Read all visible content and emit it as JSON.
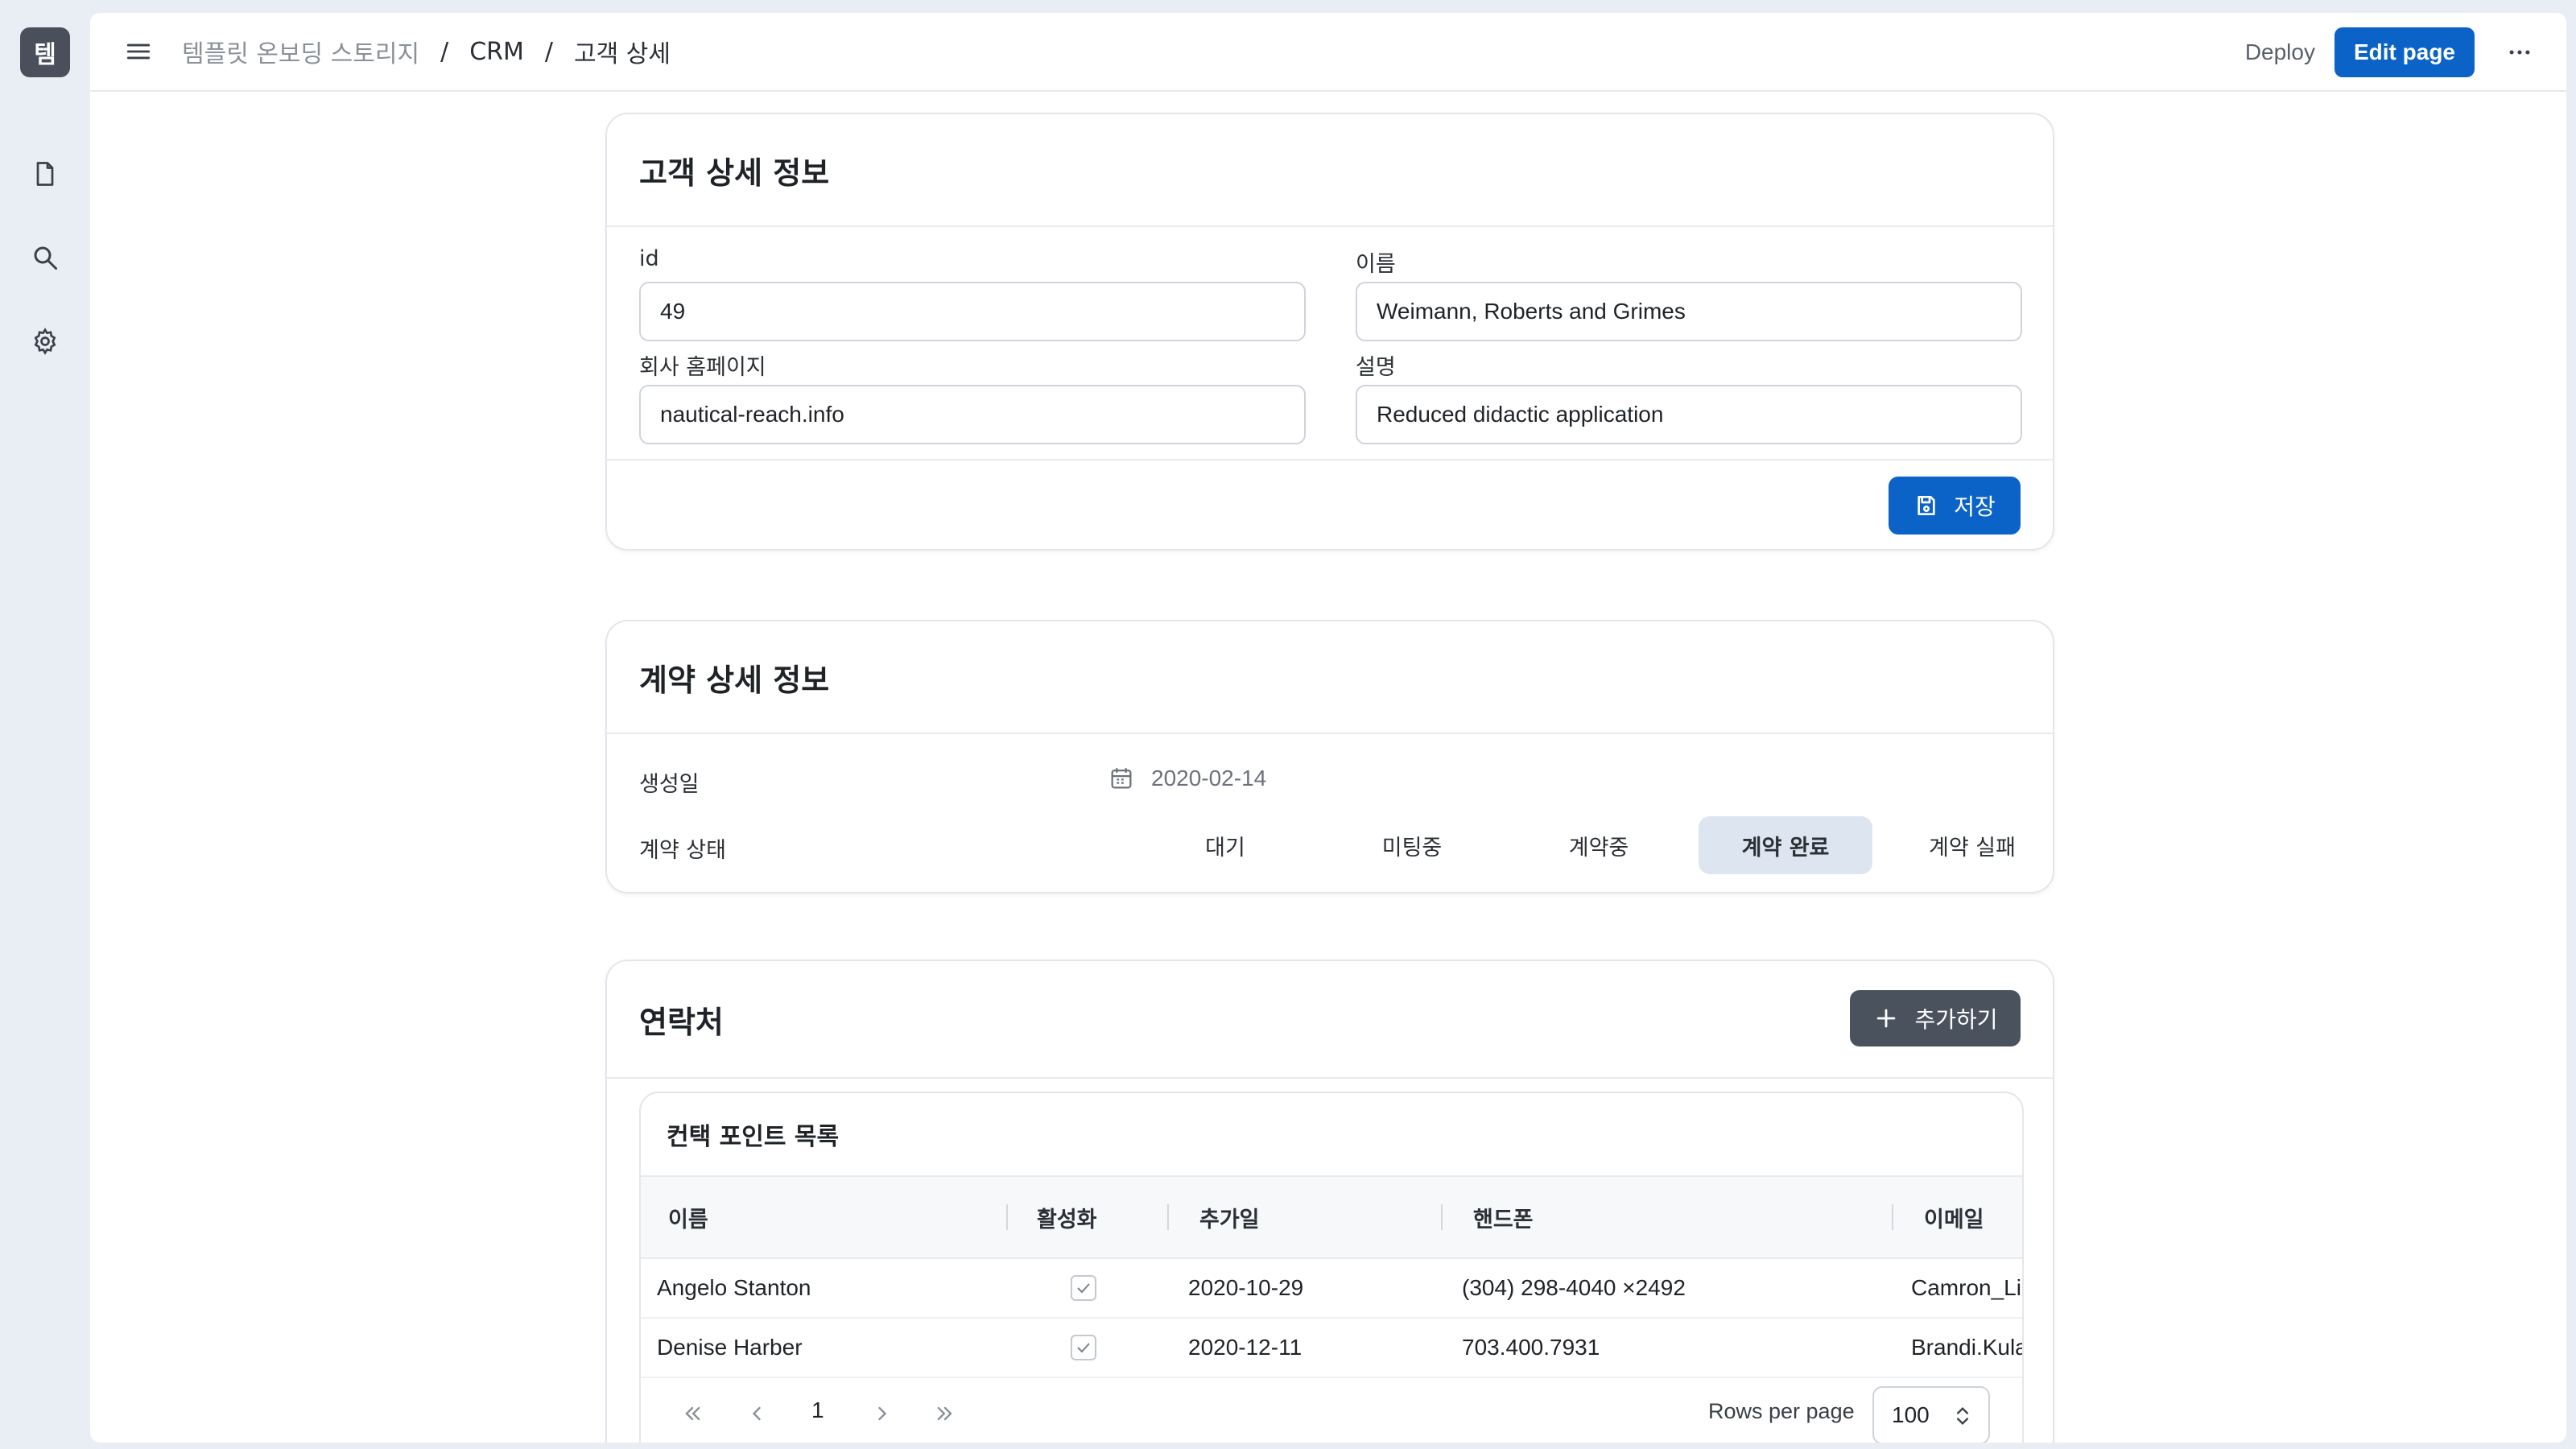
{
  "rail": {
    "app_badge": "템",
    "icons": [
      "document-icon",
      "search-icon",
      "gear-icon"
    ]
  },
  "topbar": {
    "breadcrumb": [
      "템플릿 온보딩 스토리지",
      "CRM",
      "고객 상세"
    ],
    "separator": "/",
    "deploy_label": "Deploy",
    "edit_label": "Edit page"
  },
  "customer_card": {
    "title": "고객 상세 정보",
    "fields": {
      "id_label": "id",
      "id_value": "49",
      "name_label": "이름",
      "name_value": "Weimann, Roberts and Grimes",
      "homepage_label": "회사 홈페이지",
      "homepage_value": "nautical-reach.info",
      "description_label": "설명",
      "description_value": "Reduced didactic application"
    },
    "save_label": "저장"
  },
  "contract_card": {
    "title": "계약 상세 정보",
    "created_label": "생성일",
    "created_value": "2020-02-14",
    "status_label": "계약 상태",
    "status_options": [
      "대기",
      "미팅중",
      "계약중",
      "계약 완료",
      "계약 실패"
    ],
    "status_selected": "계약 완료"
  },
  "contacts_card": {
    "title": "연락처",
    "add_label": "추가하기",
    "table": {
      "title": "컨택 포인트 목록",
      "columns": [
        "이름",
        "활성화",
        "추가일",
        "핸드폰",
        "이메일"
      ],
      "rows": [
        {
          "name": "Angelo Stanton",
          "active": true,
          "added": "2020-10-29",
          "phone": "(304) 298-4040 ×2492",
          "email": "Camron_Li"
        },
        {
          "name": "Denise Harber",
          "active": true,
          "added": "2020-12-11",
          "phone": "703.400.7931",
          "email": "Brandi.Kula"
        }
      ]
    },
    "pagination": {
      "page": "1",
      "rows_per_page_label": "Rows per page",
      "rows_per_page_value": "100"
    }
  },
  "colors": {
    "primary": "#0b63c8",
    "dark_button": "#4a525e",
    "selected_segment": "#dde6f0",
    "background": "#e9eef5"
  }
}
